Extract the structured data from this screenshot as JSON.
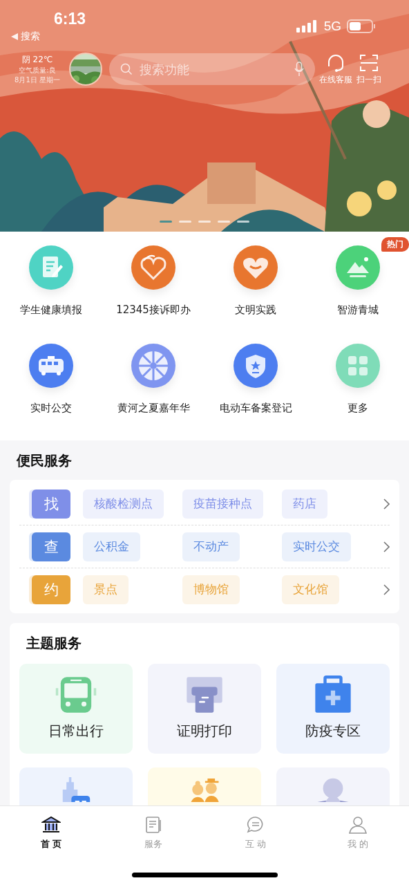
{
  "status_bar": {
    "time": "6:13",
    "network": "5G"
  },
  "back_link": {
    "label": "搜索"
  },
  "weather": {
    "condition": "阴 22℃",
    "air": "空气质量:良",
    "date": "8月1日 星期一"
  },
  "search": {
    "placeholder": "搜索功能"
  },
  "header_actions": [
    {
      "label": "在线客服",
      "kind": "headset"
    },
    {
      "label": "扫一扫",
      "kind": "scan"
    }
  ],
  "carousel": [
    {
      "selected": true
    },
    {
      "selected": false
    },
    {
      "selected": false
    },
    {
      "selected": false
    },
    {
      "selected": false
    }
  ],
  "apps": [
    {
      "label": "学生健康填报",
      "kind": "doc",
      "color": "#4fd3c4"
    },
    {
      "label": "12345接诉即办",
      "kind": "hand-heart",
      "color": "#e8762f"
    },
    {
      "label": "文明实践",
      "kind": "heart",
      "color": "#e8762f"
    },
    {
      "label": "智游青城",
      "kind": "mountain",
      "color": "#4cd27a",
      "badge": "热门"
    },
    {
      "label": "实时公交",
      "kind": "bus",
      "color": "#4d7ef0"
    },
    {
      "label": "黄河之夏嘉年华",
      "kind": "wheel",
      "color": "#7f95f0"
    },
    {
      "label": "电动车备案登记",
      "kind": "shield",
      "color": "#4d7ef0"
    },
    {
      "label": "更多",
      "kind": "grid",
      "color": "#7fdcb8"
    }
  ],
  "convenience": {
    "title": "便民服务",
    "rows": [
      {
        "tag": "找",
        "color": "#7f8fe8",
        "chips": [
          "核酸检测点",
          "疫苗接种点",
          "药店"
        ]
      },
      {
        "tag": "查",
        "color": "#5b8ae0",
        "chips": [
          "公积金",
          "不动产",
          "实时公交"
        ]
      },
      {
        "tag": "约",
        "color": "#e8a43a",
        "chips": [
          "景点",
          "博物馆",
          "文化馆"
        ]
      }
    ]
  },
  "themes": {
    "title": "主题服务",
    "tiles": [
      {
        "label": "日常出行",
        "kind": "bus",
        "color": "#eefaf3"
      },
      {
        "label": "证明打印",
        "kind": "printer",
        "color": "#f3f4fb"
      },
      {
        "label": "防疫专区",
        "kind": "medkit",
        "color": "#eef3fd"
      },
      {
        "kind": "building",
        "color": "#eef3fd"
      },
      {
        "kind": "elders",
        "color": "#fffbe8"
      },
      {
        "kind": "reader",
        "color": "#f3f4fb"
      }
    ]
  },
  "nav": [
    {
      "label": "首 页",
      "kind": "home",
      "selected": true
    },
    {
      "label": "服务",
      "kind": "doc",
      "selected": false
    },
    {
      "label": "互 动",
      "kind": "chat",
      "selected": false
    },
    {
      "label": "我 的",
      "kind": "person",
      "selected": false
    }
  ]
}
